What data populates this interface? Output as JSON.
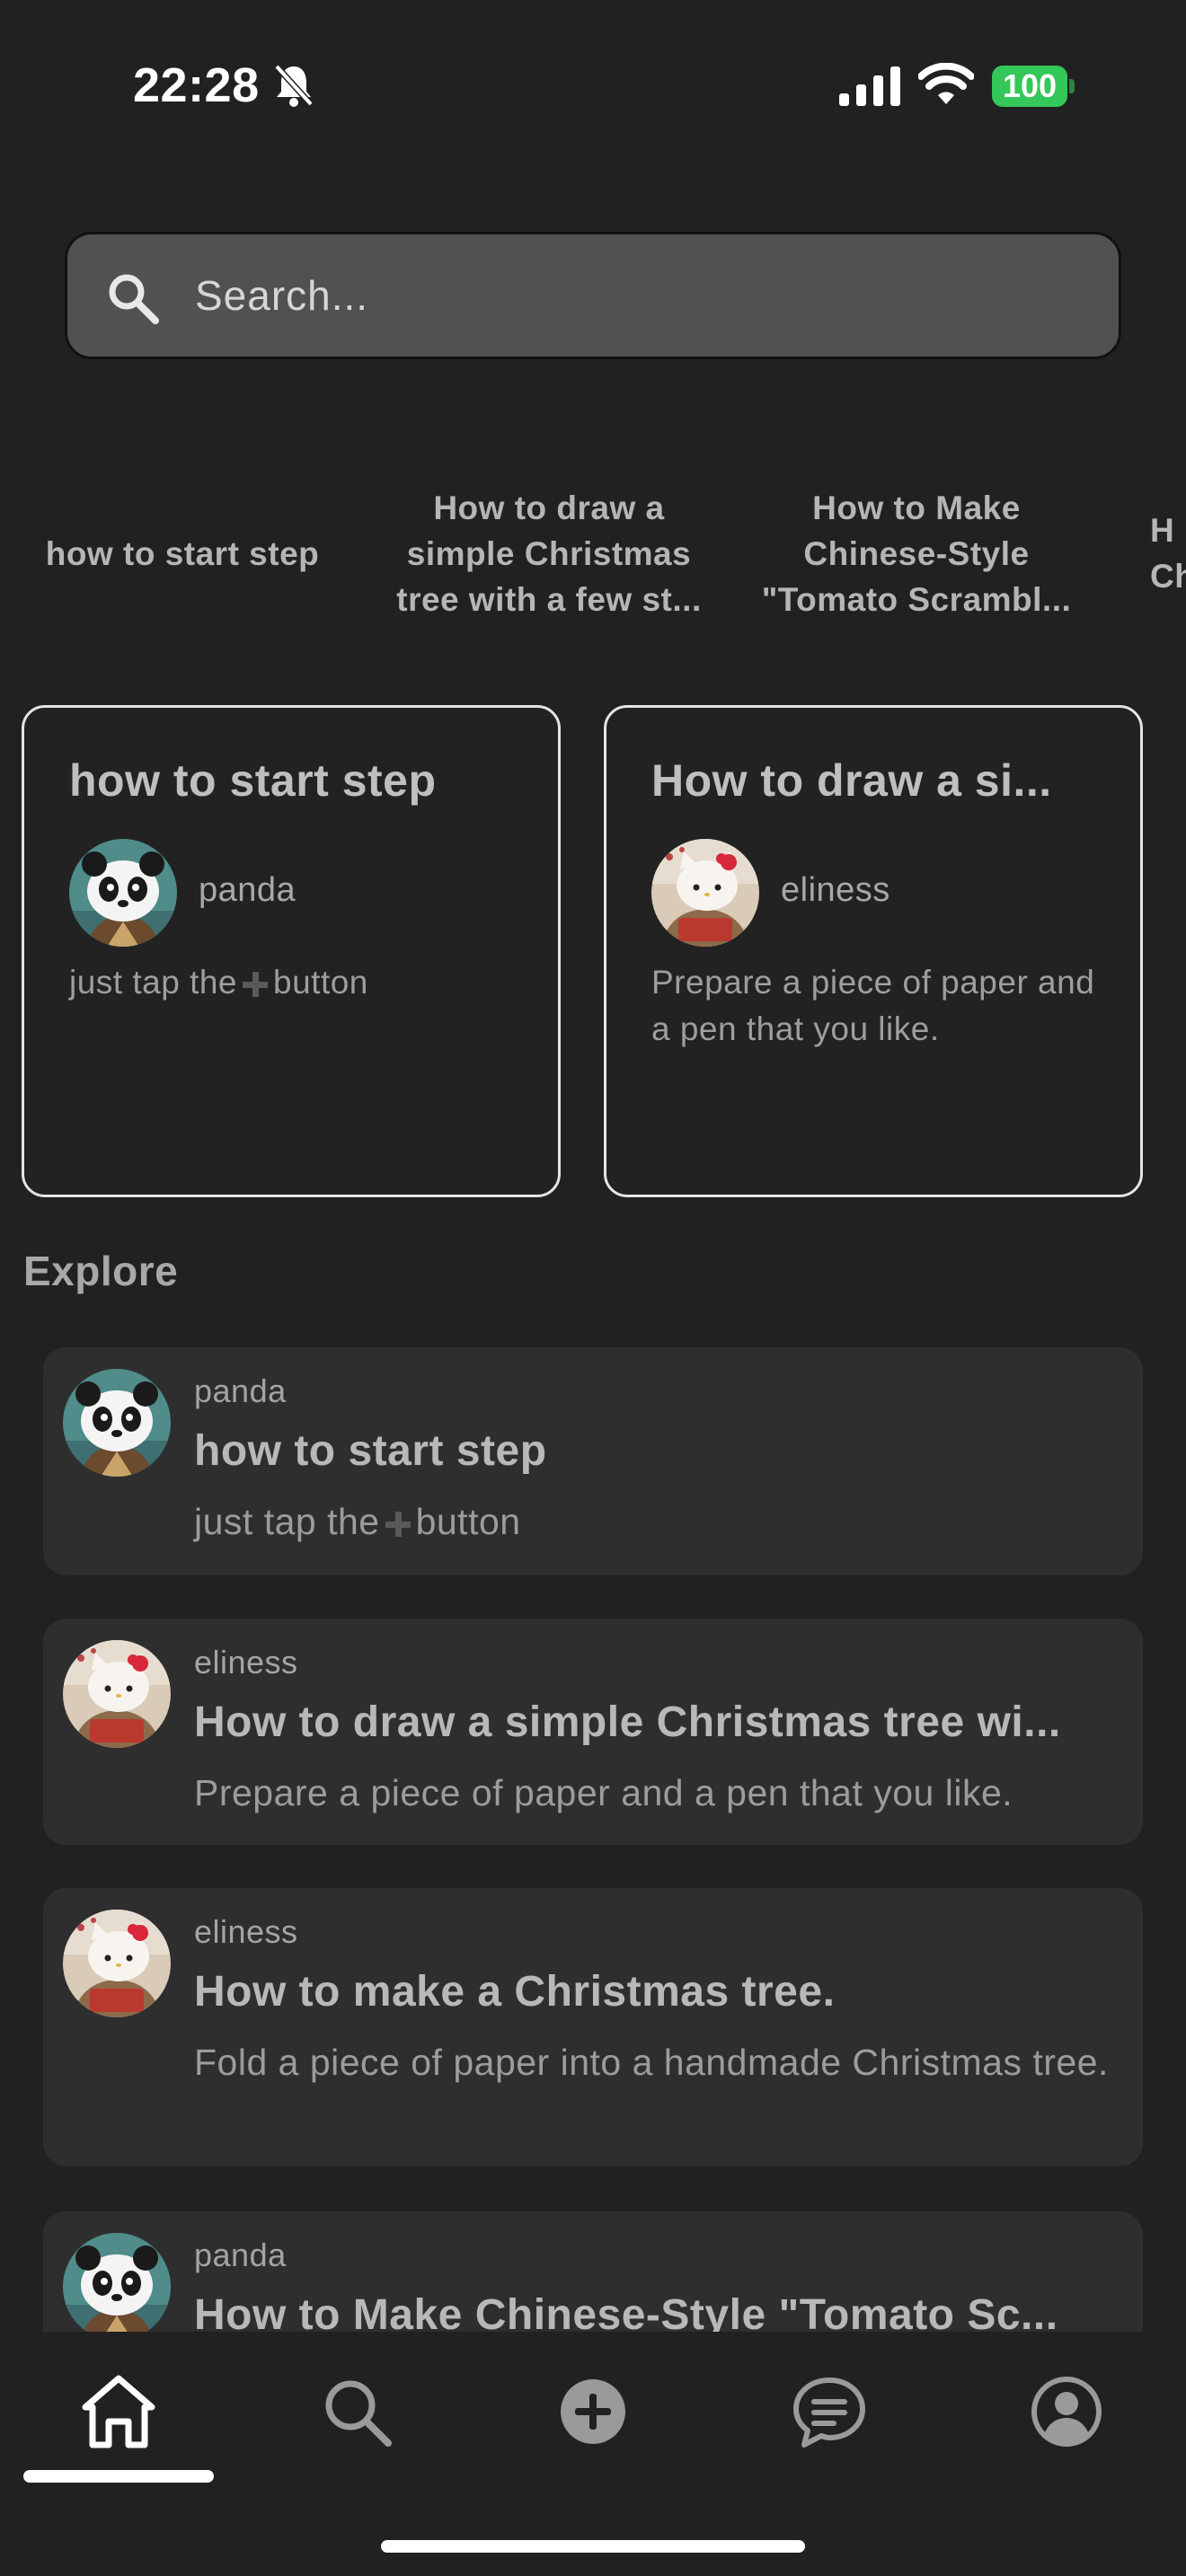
{
  "status_bar": {
    "time": "22:28",
    "battery": "100",
    "icons": [
      "bell-slash-icon",
      "cellular-signal-icon",
      "wifi-icon",
      "battery-icon"
    ]
  },
  "search": {
    "placeholder": "Search...",
    "value": "",
    "icon": "search-icon"
  },
  "quick_links": [
    {
      "lines": [
        "how to start step"
      ]
    },
    {
      "lines": [
        "How to draw a",
        "simple Christmas",
        "tree with a few st..."
      ]
    },
    {
      "lines": [
        "How to Make",
        "Chinese-Style",
        "\"Tomato Scrambl..."
      ]
    },
    {
      "lines": [
        "H",
        "Ch"
      ]
    }
  ],
  "cards": [
    {
      "title": "how to start step",
      "author": "panda",
      "avatar": "panda-avatar",
      "desc_before": "just tap the",
      "desc_icon": "plus-icon",
      "desc_after": "button"
    },
    {
      "title": "How to draw a si...",
      "author": "eliness",
      "avatar": "cat-avatar",
      "desc": "Prepare a piece of paper and a pen that you like."
    }
  ],
  "explore": {
    "title": "Explore",
    "items": [
      {
        "author": "panda",
        "avatar": "panda-avatar",
        "title": "how to start step",
        "desc_before": "just tap the",
        "desc_icon": "plus-icon",
        "desc_after": "button"
      },
      {
        "author": "eliness",
        "avatar": "cat-avatar",
        "title": "How to draw a simple Christmas tree wi...",
        "desc": "Prepare a piece of paper and a pen that you like."
      },
      {
        "author": "eliness",
        "avatar": "cat-avatar",
        "title": "How to make a Christmas tree.",
        "desc": "Fold a piece of paper into a handmade Christmas tree."
      },
      {
        "author": "panda",
        "avatar": "panda-avatar",
        "title": "How to Make Chinese-Style \"Tomato Sc...",
        "desc": ""
      }
    ]
  },
  "tab_bar": {
    "tabs": [
      {
        "name": "home",
        "icon": "home-icon",
        "selected": true
      },
      {
        "name": "search",
        "icon": "search-icon",
        "selected": false
      },
      {
        "name": "create",
        "icon": "plus-circle-icon",
        "selected": false
      },
      {
        "name": "messages",
        "icon": "chat-icon",
        "selected": false
      },
      {
        "name": "profile",
        "icon": "profile-icon",
        "selected": false
      }
    ]
  },
  "colors": {
    "background": "#212121",
    "card_bg": "#2e2e2e",
    "search_bg": "#515151",
    "battery": "#34c759",
    "text": "#bdbdbd"
  }
}
